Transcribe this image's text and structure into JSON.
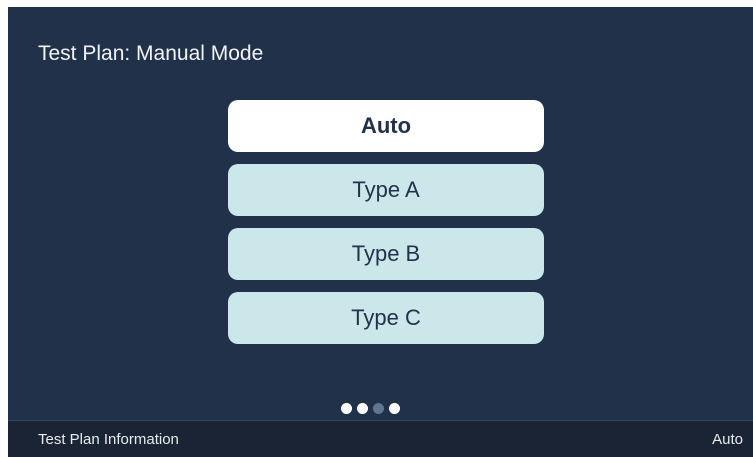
{
  "screen": {
    "title": "Test Plan: Manual Mode",
    "options": [
      {
        "label": "Auto",
        "selected": true
      },
      {
        "label": "Type A",
        "selected": false
      },
      {
        "label": "Type B",
        "selected": false
      },
      {
        "label": "Type C",
        "selected": false
      }
    ],
    "pager": {
      "total_pages": 4,
      "current_page": 3
    }
  },
  "status_bar": {
    "left_text": "Test Plan Information",
    "right_text": "Auto"
  },
  "colors": {
    "screen_background": "#21314a",
    "option_background": "#cce7ea",
    "selected_option_background": "#ffffff",
    "option_text": "#22324a",
    "status_bar_background": "#1b2434",
    "pager_dot": "#ffffff",
    "pager_dot_current": "#5f7590"
  }
}
